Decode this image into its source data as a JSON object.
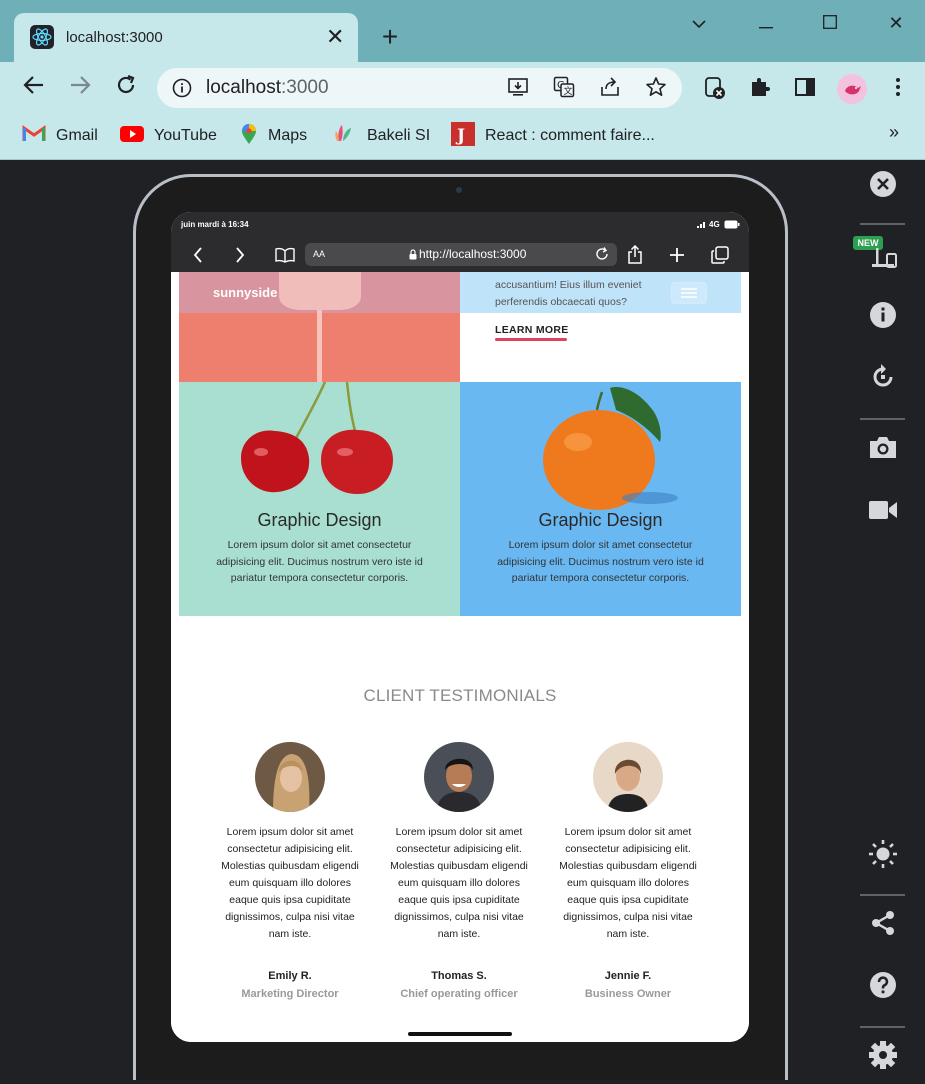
{
  "browser": {
    "tab_title": "localhost:3000",
    "url_host": "localhost",
    "url_port": ":3000",
    "bookmarks": [
      {
        "label": "Gmail",
        "icon": "gmail-icon"
      },
      {
        "label": "YouTube",
        "icon": "youtube-icon"
      },
      {
        "label": "Maps",
        "icon": "maps-icon"
      },
      {
        "label": "Bakeli SI",
        "icon": "bakeli-icon"
      },
      {
        "label": "React : comment faire...",
        "icon": "j-icon"
      }
    ],
    "more_bookmarks": "»",
    "new_badge": "NEW"
  },
  "device": {
    "status_time": "juin mardi à 16:34",
    "status_network": "4G",
    "address": "http://localhost:3000",
    "text_size": "AA"
  },
  "site": {
    "logo": "sunnyside",
    "hero_text": "accusantium! Eius illum eveniet perferendis obcaecati quos?",
    "learn_more": "LEARN MORE",
    "cards": [
      {
        "title": "Graphic Design",
        "text": "Lorem ipsum dolor sit amet consectetur adipisicing elit. Ducimus nostrum vero iste id pariatur tempora consectetur corporis."
      },
      {
        "title": "Graphic Design",
        "text": "Lorem ipsum dolor sit amet consectetur adipisicing elit. Ducimus nostrum vero iste id pariatur tempora consectetur corporis."
      }
    ],
    "testimonials_title": "CLIENT TESTIMONIALS",
    "testimonials": [
      {
        "quote": "Lorem ipsum dolor sit amet consectetur adipisicing elit. Molestias quibusdam eligendi eum quisquam illo dolores eaque quis ipsa cupiditate dignissimos, culpa nisi vitae nam iste.",
        "name": "Emily R.",
        "role": "Marketing Director"
      },
      {
        "quote": "Lorem ipsum dolor sit amet consectetur adipisicing elit. Molestias quibusdam eligendi eum quisquam illo dolores eaque quis ipsa cupiditate dignissimos, culpa nisi vitae nam iste.",
        "name": "Thomas S.",
        "role": "Chief operating officer"
      },
      {
        "quote": "Lorem ipsum dolor sit amet consectetur adipisicing elit. Molestias quibusdam eligendi eum quisquam illo dolores eaque quis ipsa cupiditate dignissimos, culpa nisi vitae nam iste.",
        "name": "Jennie F.",
        "role": "Business Owner"
      }
    ]
  },
  "colors": {
    "tab_bg": "#c7e8ea",
    "tabbar_bg": "#6fb0b8",
    "card_left_bg": "#a9dfd1",
    "card_right_bg": "#6ab8f1",
    "hero_salmon": "#ee7e6d",
    "learn_more_underline": "#e0415b"
  }
}
